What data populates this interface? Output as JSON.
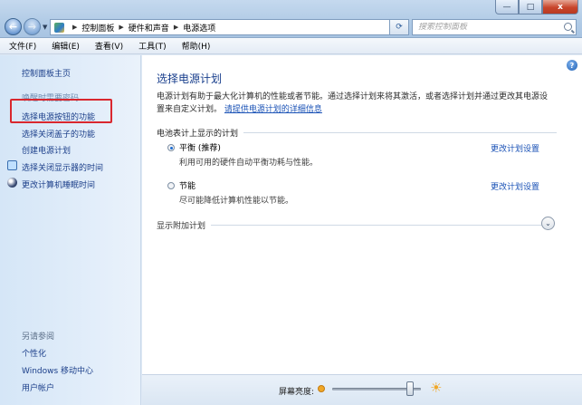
{
  "window": {
    "minimize": "—",
    "maximize": "□",
    "close": "x"
  },
  "breadcrumb": [
    "控制面板",
    "硬件和声音",
    "电源选项"
  ],
  "search": {
    "placeholder": "搜索控制面板"
  },
  "menu": [
    "文件(F)",
    "编辑(E)",
    "查看(V)",
    "工具(T)",
    "帮助(H)"
  ],
  "sidebar": {
    "home": "控制面板主页",
    "items": [
      "唤醒时需要密码",
      "选择电源按钮的功能",
      "选择关闭盖子的功能",
      "创建电源计划",
      "选择关闭显示器的时间",
      "更改计算机睡眠时间"
    ],
    "see_also_title": "另请参阅",
    "see_also": [
      "个性化",
      "Windows 移动中心",
      "用户帐户"
    ]
  },
  "main": {
    "title": "选择电源计划",
    "desc_text": "电源计划有助于最大化计算机的性能或者节能。通过选择计划来将其激活，或者选择计划并通过更改其电源设置来自定义计划。",
    "desc_link": "请提供电源计划的详细信息",
    "battery_section": "电池表计上显示的计划",
    "plans": [
      {
        "name": "平衡 (推荐)",
        "desc": "利用可用的硬件自动平衡功耗与性能。",
        "selected": true,
        "change": "更改计划设置"
      },
      {
        "name": "节能",
        "desc": "尽可能降低计算机性能以节能。",
        "selected": false,
        "change": "更改计划设置"
      }
    ],
    "more_plans": "显示附加计划",
    "help_glyph": "?",
    "expand_glyph": "⌄"
  },
  "brightness": {
    "label": "屏幕亮度:",
    "level": 0.88,
    "bright_glyph": "☀"
  }
}
